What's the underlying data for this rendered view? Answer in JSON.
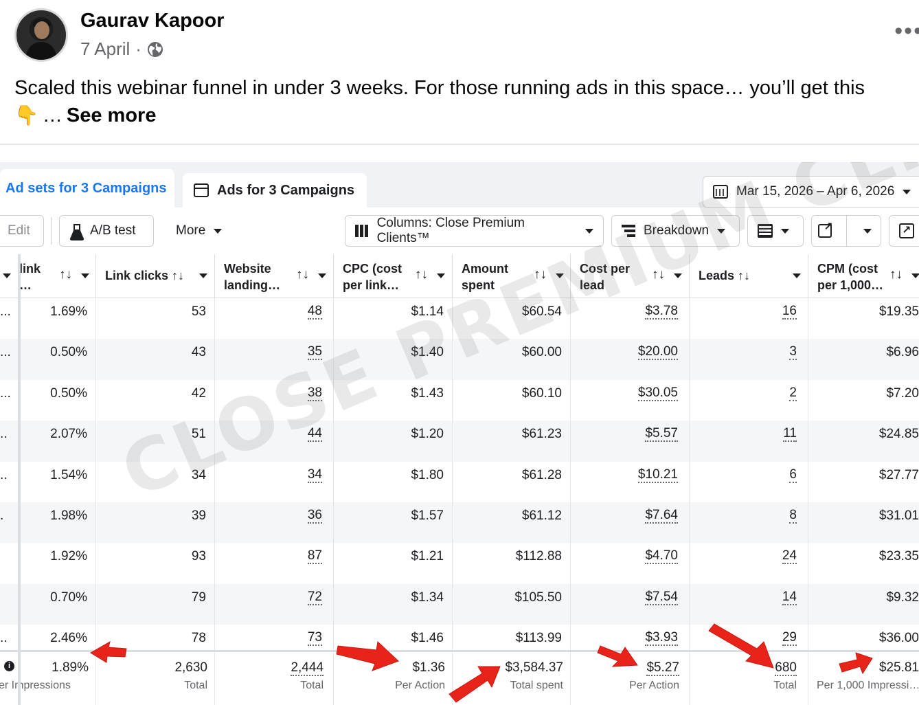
{
  "post": {
    "author": "Gaurav Kapoor",
    "date": "7 April",
    "date_separator": "·",
    "more_label": "•••",
    "text_line1": "Scaled this webinar funnel in under 3 weeks. For those running ads in this space… you’ll get this",
    "pointer_emoji": "👇",
    "ellipsis": "…",
    "see_more": "See more"
  },
  "ads_manager": {
    "tabs": [
      {
        "label": "Ad sets for 3 Campaigns",
        "active": true
      },
      {
        "label": "Ads for 3 Campaigns",
        "active": false
      }
    ],
    "date_range": "Mar 15, 2026 – Apr 6, 2026",
    "toolbar": {
      "edit": "Edit",
      "ab_test": "A/B test",
      "more": "More",
      "columns": "Columns: Close Premium Clients™",
      "breakdown": "Breakdown"
    },
    "watermark": "CLOSE PREMIUM CLIENTS",
    "columns": [
      {
        "key": "ctr",
        "label": "link\n…",
        "sort": "↑↓"
      },
      {
        "key": "link_clicks",
        "label": "Link clicks ↑↓"
      },
      {
        "key": "website_landing",
        "label": "Website\nlanding…",
        "sort": "↑↓"
      },
      {
        "key": "cpc",
        "label": "CPC (cost\nper link…",
        "sort": "↑↓"
      },
      {
        "key": "amount_spent",
        "label": "Amount\nspent",
        "sort": "↑↓"
      },
      {
        "key": "cost_per_lead",
        "label": "Cost per\nlead",
        "sort": "↑↓"
      },
      {
        "key": "leads",
        "label": "Leads ↑↓"
      },
      {
        "key": "cpm",
        "label": "CPM (cost\nper 1,000…",
        "sort": "↑↓"
      }
    ],
    "rows": [
      {
        "stub": "...",
        "ctr": "1.69%",
        "link_clicks": "53",
        "website_landing": "48",
        "cpc": "$1.14",
        "amount_spent": "$60.54",
        "cost_per_lead": "$3.78",
        "leads": "16",
        "cpm": "$19.35"
      },
      {
        "stub": "...",
        "ctr": "0.50%",
        "link_clicks": "43",
        "website_landing": "35",
        "cpc": "$1.40",
        "amount_spent": "$60.00",
        "cost_per_lead": "$20.00",
        "leads": "3",
        "cpm": "$6.96"
      },
      {
        "stub": "...",
        "ctr": "0.50%",
        "link_clicks": "42",
        "website_landing": "38",
        "cpc": "$1.43",
        "amount_spent": "$60.10",
        "cost_per_lead": "$30.05",
        "leads": "2",
        "cpm": "$7.20"
      },
      {
        "stub": "..",
        "ctr": "2.07%",
        "link_clicks": "51",
        "website_landing": "44",
        "cpc": "$1.20",
        "amount_spent": "$61.23",
        "cost_per_lead": "$5.57",
        "leads": "11",
        "cpm": "$24.85"
      },
      {
        "stub": "..",
        "ctr": "1.54%",
        "link_clicks": "34",
        "website_landing": "34",
        "cpc": "$1.80",
        "amount_spent": "$61.28",
        "cost_per_lead": "$10.21",
        "leads": "6",
        "cpm": "$27.77"
      },
      {
        "stub": ".",
        "ctr": "1.98%",
        "link_clicks": "39",
        "website_landing": "36",
        "cpc": "$1.57",
        "amount_spent": "$61.12",
        "cost_per_lead": "$7.64",
        "leads": "8",
        "cpm": "$31.01"
      },
      {
        "stub": "",
        "ctr": "1.92%",
        "link_clicks": "93",
        "website_landing": "87",
        "cpc": "$1.21",
        "amount_spent": "$112.88",
        "cost_per_lead": "$4.70",
        "leads": "24",
        "cpm": "$23.35"
      },
      {
        "stub": "",
        "ctr": "0.70%",
        "link_clicks": "79",
        "website_landing": "72",
        "cpc": "$1.34",
        "amount_spent": "$105.50",
        "cost_per_lead": "$7.54",
        "leads": "14",
        "cpm": "$9.32"
      },
      {
        "stub": "..",
        "ctr": "2.46%",
        "link_clicks": "78",
        "website_landing": "73",
        "cpc": "$1.46",
        "amount_spent": "$113.99",
        "cost_per_lead": "$3.93",
        "leads": "29",
        "cpm": "$36.00"
      }
    ],
    "totals": {
      "ctr": {
        "value": "1.89%",
        "label": "er Impressions"
      },
      "link_clicks": {
        "value": "2,630",
        "label": "Total"
      },
      "website_landing": {
        "value": "2,444",
        "label": "Total"
      },
      "cpc": {
        "value": "$1.36",
        "label": "Per Action"
      },
      "amount_spent": {
        "value": "$3,584.37",
        "label": "Total spent"
      },
      "cost_per_lead": {
        "value": "$5.27",
        "label": "Per Action"
      },
      "leads": {
        "value": "680",
        "label": "Total"
      },
      "cpm": {
        "value": "$25.81",
        "label": "Per 1,000 Impressi…"
      }
    },
    "colors": {
      "accent": "#1877f2",
      "annotation_arrow": "#e8231a",
      "muted": "#65676b"
    }
  }
}
